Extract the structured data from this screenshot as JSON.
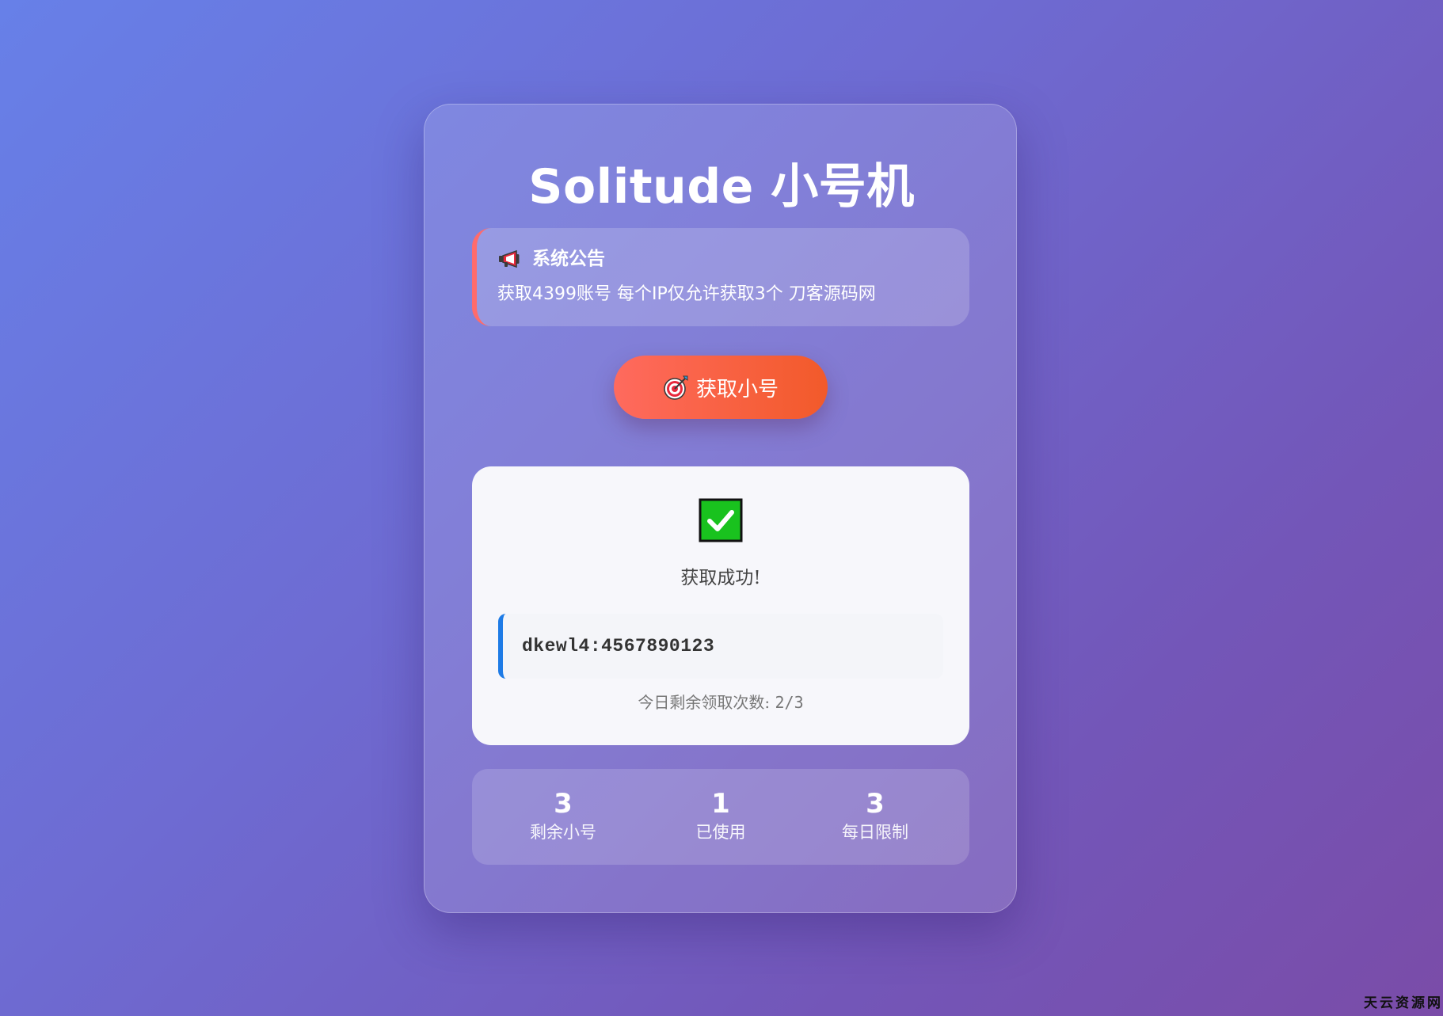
{
  "app": {
    "title": "Solitude 小号机"
  },
  "notice": {
    "icon": "megaphone-icon",
    "heading": "系统公告",
    "text": "获取4399账号 每个IP仅允许获取3个 刀客源码网",
    "accent_color": "#ff6b6b"
  },
  "action": {
    "icon": "target-icon",
    "label": "获取小号",
    "gradient": [
      "#ff6a5e",
      "#f25a2a"
    ]
  },
  "result": {
    "icon": "check-mark-icon",
    "message": "获取成功!",
    "account": "dkewl4:4567890123",
    "remaining_label": "今日剩余领取次数:",
    "remaining_value": "2/3",
    "accent_color": "#1e7be6"
  },
  "stats": [
    {
      "value": "3",
      "label": "剩余小号"
    },
    {
      "value": "1",
      "label": "已使用"
    },
    {
      "value": "3",
      "label": "每日限制"
    }
  ],
  "watermark": "天云资源网"
}
